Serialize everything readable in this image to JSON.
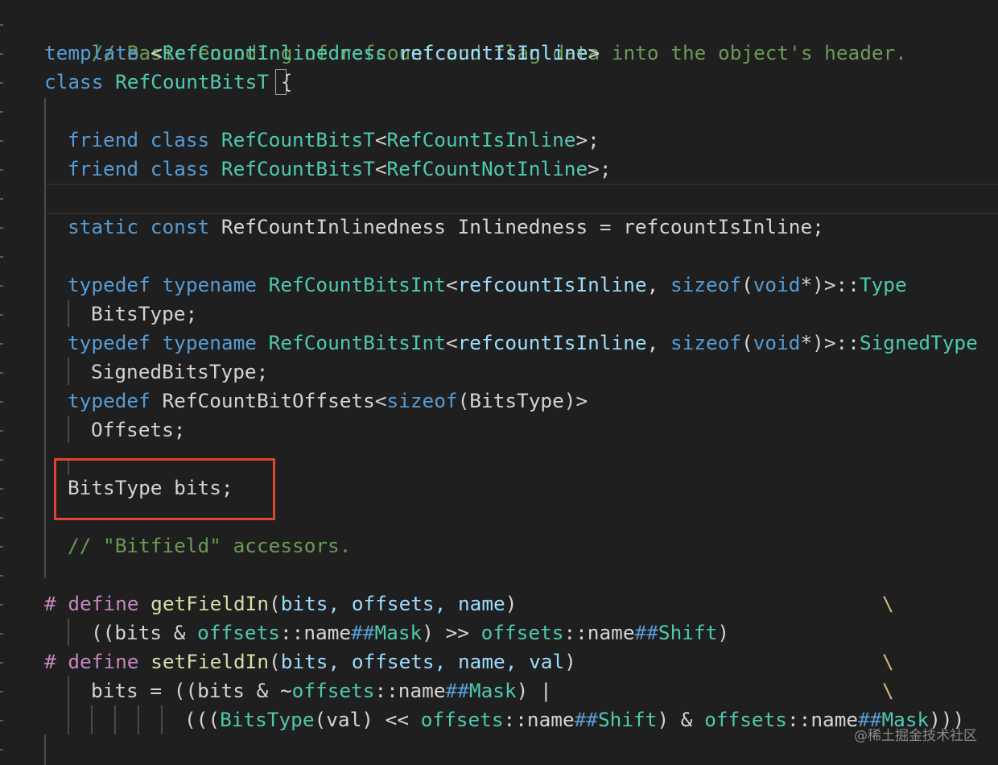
{
  "colors": {
    "background": "#1f1f1f",
    "comment": "#6a9955",
    "keyword": "#569cd6",
    "type": "#4ec9b0",
    "identifier": "#9cdcfe",
    "plain": "#d4d4d4",
    "preprocessor": "#c586c0",
    "function": "#dcdcaa",
    "highlight_border": "#e0452f"
  },
  "code": {
    "l1": {
      "comment": "// Basic encoding of refcount and flag data into the object's header."
    },
    "l2": {
      "kw": "template",
      "lt": " <",
      "type": "RefCountInlinedness",
      "sp": " ",
      "param": "refcountIsInline",
      "gt": ">"
    },
    "l3": {
      "kw": "class",
      "sp": " ",
      "name": "RefCountBitsT",
      "sp2": " ",
      "brace": "{"
    },
    "l5": {
      "kw1": "friend",
      "kw2": "class",
      "type": "RefCountBitsT",
      "lt": "<",
      "arg": "RefCountIsInline",
      "end": ">;"
    },
    "l6": {
      "kw1": "friend",
      "kw2": "class",
      "type": "RefCountBitsT",
      "lt": "<",
      "arg": "RefCountNotInline",
      "end": ">;"
    },
    "l8": {
      "kw1": "static",
      "kw2": "const",
      "rest": " RefCountInlinedness Inlinedness = refcountIsInline;"
    },
    "l10": {
      "kw1": "typedef",
      "kw2": "typename",
      "type": "RefCountBitsInt",
      "lt": "<",
      "arg": "refcountIsInline",
      "comma": ", ",
      "sizeof": "sizeof",
      "paren": "(",
      "void": "void",
      "star": "*)>::",
      "member": "Type"
    },
    "l11": {
      "text": "BitsType;"
    },
    "l12": {
      "kw1": "typedef",
      "kw2": "typename",
      "type": "RefCountBitsInt",
      "lt": "<",
      "arg": "refcountIsInline",
      "comma": ", ",
      "sizeof": "sizeof",
      "paren": "(",
      "void": "void",
      "star": "*)>::",
      "member": "SignedType"
    },
    "l13": {
      "text": "SignedBitsType;"
    },
    "l14": {
      "kw": "typedef",
      "rest": " RefCountBitOffsets<",
      "sizeof": "sizeof",
      "end": "(BitsType)>"
    },
    "l15": {
      "text": "Offsets;"
    },
    "l17": {
      "text": "BitsType bits;"
    },
    "l19": {
      "comment": "// \"Bitfield\" accessors."
    },
    "l21": {
      "hash": "#",
      "define": "define",
      "fn": "getFieldIn",
      "open": "(",
      "params": "bits, offsets, name",
      "close": ")",
      "bs": "\\"
    },
    "l22": {
      "p1": "((bits & ",
      "id1": "offsets",
      "p2": "::name",
      "h1": "##",
      "t1": "Mask",
      "p3": ") >> ",
      "id2": "offsets",
      "p4": "::name",
      "h2": "##",
      "t2": "Shift",
      "p5": ")"
    },
    "l23": {
      "hash": "#",
      "define": "define",
      "fn": "setFieldIn",
      "open": "(",
      "params": "bits, offsets, name, val",
      "close": ")",
      "bs": "\\"
    },
    "l24": {
      "p1": "bits = ((bits & ~",
      "id1": "offsets",
      "p2": "::name",
      "h1": "##",
      "t1": "Mask",
      "p3": ") |",
      "bs": "\\"
    },
    "l25": {
      "p1": "(((",
      "fn": "BitsType",
      "p2": "(val) << ",
      "id1": "offsets",
      "p3": "::name",
      "h1": "##",
      "t1": "Shift",
      "p4": ") & ",
      "id2": "offsets",
      "p5": "::name",
      "h2": "##",
      "t2": "Mask",
      "p6": ")))"
    }
  },
  "watermark": "@稀土掘金技术社区"
}
